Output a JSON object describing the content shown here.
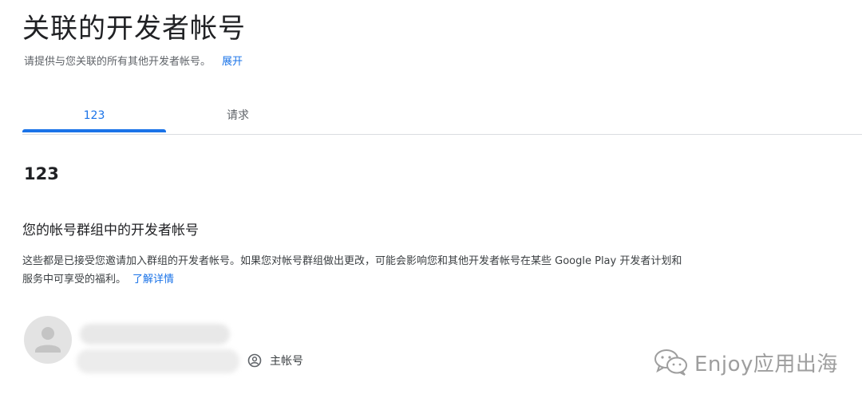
{
  "header": {
    "title": "关联的开发者帐号",
    "subtitle": "请提供与您关联的所有其他开发者帐号。",
    "expand_link": "展开"
  },
  "tabs": [
    {
      "label": "123",
      "active": true
    },
    {
      "label": "请求",
      "active": false
    }
  ],
  "section": {
    "heading": "123",
    "group_title": "您的帐号群组中的开发者帐号",
    "group_description_line1": "这些都是已接受您邀请加入群组的开发者帐号。如果您对帐号群组做出更改，可能会影响您和其他开发者帐号在某些 Google Play 开发者计划和",
    "group_description_line2": "服务中可享受的福利。",
    "learn_more_link": "了解详情"
  },
  "account": {
    "avatar_icon": "person-icon",
    "role_icon": "account-circle-icon",
    "role_label": "主帐号"
  },
  "watermark": {
    "icon": "wechat-icon",
    "text": "Enjoy应用出海"
  },
  "colors": {
    "accent": "#1a73e8",
    "text_primary": "#202124",
    "text_secondary": "#5f6368",
    "divider": "#dadce0"
  }
}
